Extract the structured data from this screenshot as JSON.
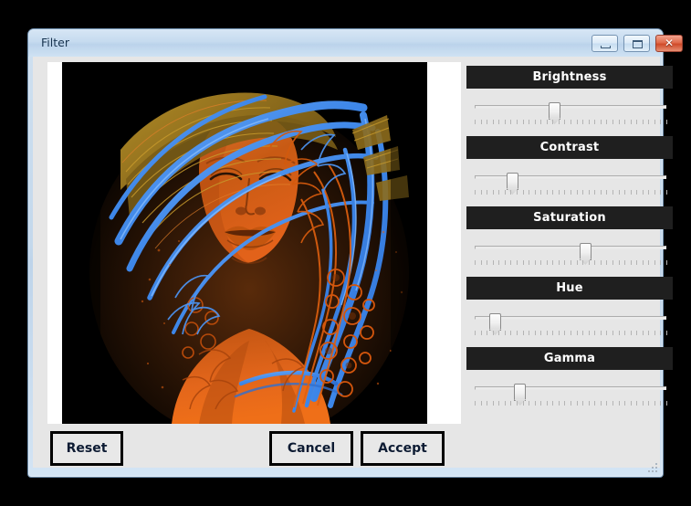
{
  "window": {
    "title": "Filter",
    "buttons": {
      "minimize": "minimize",
      "maximize": "maximize",
      "close": "✕"
    }
  },
  "preview": {
    "alt": "Illustration of a woman's face with orange skin tones and flowing blue and orange hair on a black background",
    "colors": {
      "background": "#000000",
      "skin": "#c85a14",
      "skin_shadow": "#8a3a0c",
      "hair_blue": "#3d86e8",
      "hair_blue_light": "#6aa8f5",
      "hair_gold": "#9c7a22",
      "hair_orange": "#e0600f",
      "outline": "#2a1405"
    }
  },
  "controls": [
    {
      "name": "brightness",
      "label": "Brightness",
      "value": 41
    },
    {
      "name": "contrast",
      "label": "Contrast",
      "value": 19
    },
    {
      "name": "saturation",
      "label": "Saturation",
      "value": 57
    },
    {
      "name": "hue",
      "label": "Hue",
      "value": 10
    },
    {
      "name": "gamma",
      "label": "Gamma",
      "value": 23
    }
  ],
  "control_style": {
    "label_background": "#1f1f1f",
    "label_color": "#ffffff",
    "track_color": "#ebebeb",
    "tick_color": "#b4b4b4",
    "tick_count": 33
  },
  "footer": {
    "reset_label": "Reset",
    "cancel_label": "Cancel",
    "accept_label": "Accept"
  }
}
